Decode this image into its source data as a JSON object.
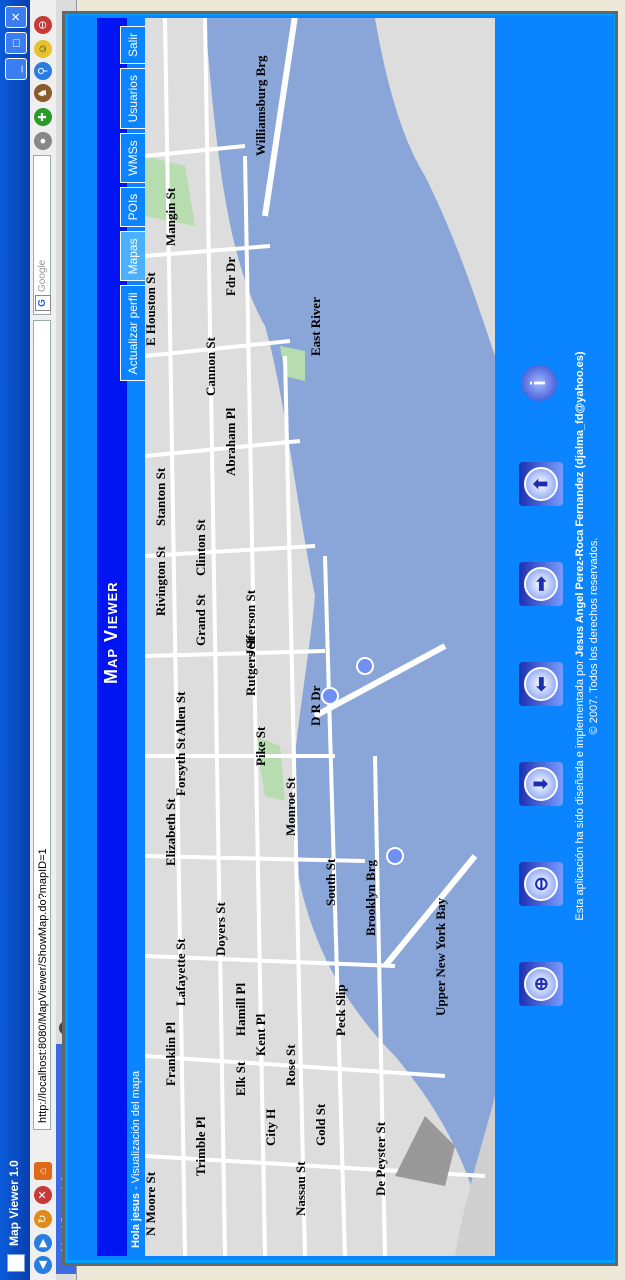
{
  "window": {
    "title": "Map Viewer 1.0",
    "url": "http://localhost:8080/MapViewer/ShowMap.do?mapID=1",
    "search_placeholder": "Google",
    "tab_label": "Map Viewer 1.0"
  },
  "header": {
    "title": "Map Viewer",
    "greeting_name": "Hola jesus",
    "greeting_rest": " - Visualización del mapa"
  },
  "menu": [
    {
      "label": "Actualizar perfil"
    },
    {
      "label": "Mapas"
    },
    {
      "label": "POIs"
    },
    {
      "label": "WMSs"
    },
    {
      "label": "Usuarios"
    },
    {
      "label": "Salir"
    }
  ],
  "map_labels": {
    "williamsburg": "Williamsburg Brg",
    "east_river": "East River",
    "mangin": "Mangin St",
    "fdr": "Fdr Dr",
    "e_houston": "E Houston St",
    "cannon": "Cannon St",
    "abraham": "Abraham Pl",
    "stanton": "Stanton St",
    "clinton": "Clinton St",
    "rivington": "Rivington St",
    "grand": "Grand St",
    "jefferson": "Jefferson St",
    "rutgers": "Rutgers St",
    "dr_dr": "D R Dr",
    "allen": "Allen St",
    "pike": "Pike St",
    "forsyth": "Forsyth St",
    "monroe": "Monroe St",
    "elizabeth": "Elizabeth St",
    "south": "South St",
    "brooklyn": "Brooklyn Brg",
    "doyers": "Doyers St",
    "upper_ny_bay": "Upper New York Bay",
    "lafayette": "Lafayette St",
    "hamill": "Hamill Pl",
    "kent": "Kent Pl",
    "peck": "Peck Slip",
    "franklin": "Franklin Pl",
    "elk": "Elk St",
    "rose": "Rose St",
    "city_hall": "City H",
    "gold": "Gold St",
    "trimble": "Trimble Pl",
    "nassau": "Nassau St",
    "depeyster": "De Peyster St",
    "n_moore": "N Moore St"
  },
  "controls": {
    "info_icon": "info-icon",
    "zoom_in_icon": "zoom-in-icon",
    "zoom_out_icon": "zoom-out-icon"
  },
  "footer": {
    "credit_prefix": "Esta aplicación ha sido diseñada e implementada por ",
    "credit_author": "Jesus Angel Perez-Roca Fernandez (djalma_fd@yahoo.es)",
    "copyright": "© 2007. Todos los derechos reservados."
  },
  "colors": {
    "page_blue": "#0a84ff",
    "title_band": "#0015f2",
    "water": "#8aa6d8",
    "land": "#dddddd",
    "park": "#b6dcb0"
  }
}
